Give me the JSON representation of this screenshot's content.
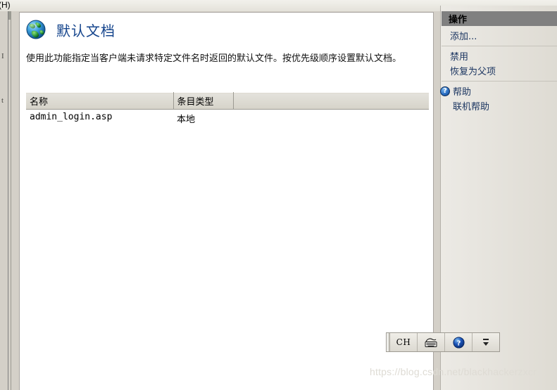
{
  "window": {
    "menu_tail_label": "(H)"
  },
  "left_frame": {
    "ghost_glyph_1": "I",
    "ghost_glyph_2": "t"
  },
  "page": {
    "icon": "globe-icon",
    "title": "默认文档",
    "description": "使用此功能指定当客户端未请求特定文件名时返回的默认文件。按优先级顺序设置默认文档。"
  },
  "table": {
    "columns": [
      "名称",
      "条目类型",
      ""
    ],
    "rows": [
      {
        "name": "admin_login.asp",
        "entry_type": "本地"
      }
    ]
  },
  "actions": {
    "title": "操作",
    "groups": [
      {
        "items": [
          {
            "label": "添加...",
            "icon": null
          }
        ]
      },
      {
        "items": [
          {
            "label": "禁用",
            "icon": null
          },
          {
            "label": "恢复为父项",
            "icon": null
          }
        ]
      },
      {
        "items": [
          {
            "label": "帮助",
            "icon": "help-icon"
          },
          {
            "label": "联机帮助",
            "icon": null
          }
        ]
      }
    ]
  },
  "ime_bar": {
    "language": "CH",
    "keyboard_icon": "keyboard-icon",
    "help_icon": "help-icon",
    "minimize_icon": "minimize-icon",
    "expand_icon": "chevron-down-icon"
  },
  "watermark": {
    "text": "https://blog.csdn.net/blackhackerzxcr"
  },
  "colors": {
    "title_blue": "#14448c",
    "link_navy": "#19335f",
    "actions_header_gray": "#808080",
    "panel_bg": "#d4d0c8",
    "content_bg": "#ffffff"
  }
}
